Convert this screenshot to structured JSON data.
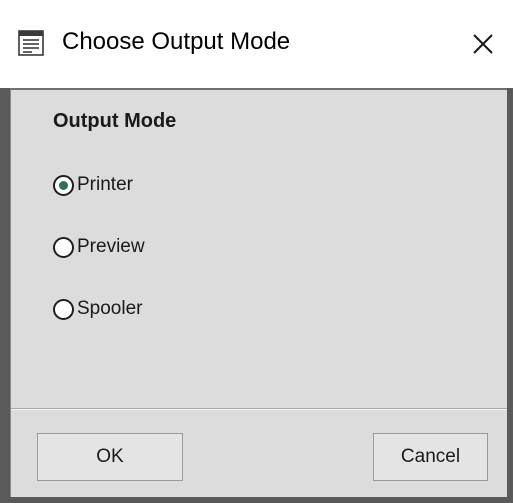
{
  "window": {
    "title": "Choose Output Mode",
    "icon": "form-window-icon",
    "close_icon": "close-icon"
  },
  "group": {
    "title": "Output Mode"
  },
  "options": [
    {
      "label": "Printer",
      "selected": true
    },
    {
      "label": "Preview",
      "selected": false
    },
    {
      "label": "Spooler",
      "selected": false
    }
  ],
  "buttons": {
    "ok_label": "OK",
    "cancel_label": "Cancel"
  },
  "colors": {
    "radio_dot": "#2e6f5e",
    "client_bg": "#dcdcdc",
    "frame": "#5a5a5a"
  }
}
